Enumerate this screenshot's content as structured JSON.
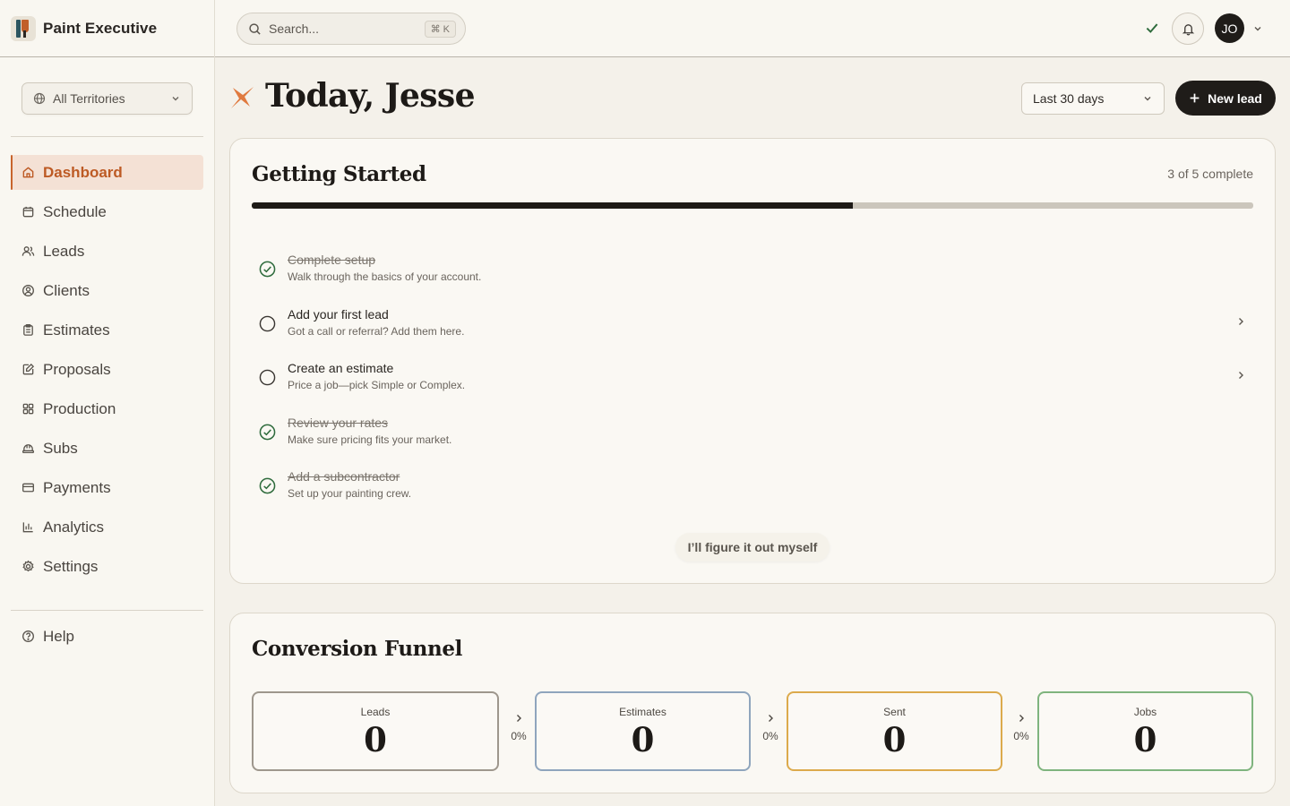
{
  "brand": {
    "name": "Paint Executive"
  },
  "sidebar": {
    "territory": "All Territories",
    "items": [
      {
        "label": "Dashboard",
        "icon": "home-icon"
      },
      {
        "label": "Schedule",
        "icon": "calendar-icon"
      },
      {
        "label": "Leads",
        "icon": "users-icon"
      },
      {
        "label": "Clients",
        "icon": "user-circle-icon"
      },
      {
        "label": "Estimates",
        "icon": "clipboard-icon"
      },
      {
        "label": "Proposals",
        "icon": "edit-icon"
      },
      {
        "label": "Production",
        "icon": "grid-icon"
      },
      {
        "label": "Subs",
        "icon": "hard-hat-icon"
      },
      {
        "label": "Payments",
        "icon": "credit-card-icon"
      },
      {
        "label": "Analytics",
        "icon": "bar-chart-icon"
      },
      {
        "label": "Settings",
        "icon": "gear-icon"
      }
    ],
    "help": "Help"
  },
  "header": {
    "search_placeholder": "Search...",
    "shortcut": "⌘ K",
    "avatar_initials": "JO"
  },
  "page": {
    "title": "Today, Jesse",
    "date_range": "Last 30 days",
    "new_lead": "New lead"
  },
  "getting_started": {
    "title": "Getting Started",
    "progress_label": "3 of 5 complete",
    "progress_fraction": 0.6,
    "tasks": [
      {
        "title": "Complete setup",
        "desc": "Walk through the basics of your account.",
        "done": true
      },
      {
        "title": "Add your first lead",
        "desc": "Got a call or referral? Add them here.",
        "done": false
      },
      {
        "title": "Create an estimate",
        "desc": "Price a job—pick Simple or Complex.",
        "done": false
      },
      {
        "title": "Review your rates",
        "desc": "Make sure pricing fits your market.",
        "done": true
      },
      {
        "title": "Add a subcontractor",
        "desc": "Set up your painting crew.",
        "done": true
      }
    ],
    "dismiss": "I’ll figure it out myself"
  },
  "funnel": {
    "title": "Conversion Funnel",
    "stages": [
      {
        "label": "Leads",
        "value": "0",
        "color": "#9e978d"
      },
      {
        "label": "Estimates",
        "value": "0",
        "color": "#8fa5bd"
      },
      {
        "label": "Sent",
        "value": "0",
        "color": "#dcaa4c"
      },
      {
        "label": "Jobs",
        "value": "0",
        "color": "#7fb47e"
      }
    ],
    "rates": [
      "0%",
      "0%",
      "0%"
    ]
  },
  "colors": {
    "accent": "#c8642c",
    "accent_bg": "#f4e1d5",
    "dark": "#1f1c19",
    "success": "#2e6b3c"
  }
}
